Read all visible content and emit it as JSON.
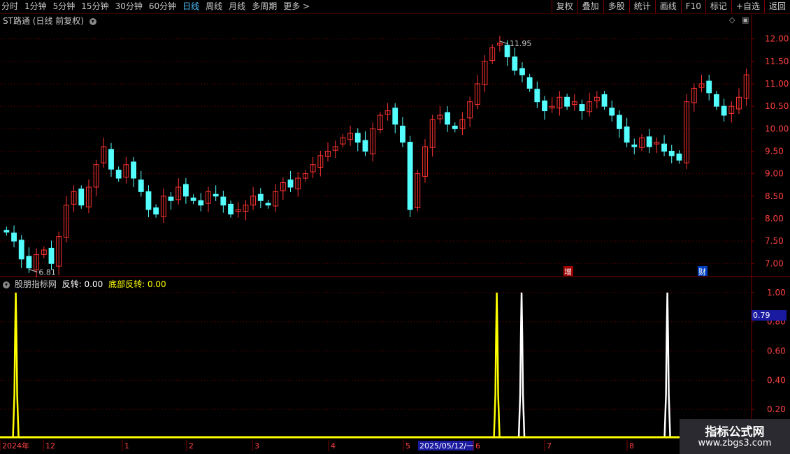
{
  "toolbar": {
    "periods": [
      "分时",
      "1分钟",
      "5分钟",
      "15分钟",
      "30分钟",
      "60分钟",
      "日线",
      "周线",
      "月线",
      "多周期",
      "更多 >"
    ],
    "active_period": "日线",
    "right_buttons": [
      "复权",
      "叠加",
      "多股",
      "统计",
      "画线",
      "F10",
      "标记",
      "+自选",
      "返回"
    ]
  },
  "stock": {
    "name": "ST路通",
    "mode": "(日线 前复权)",
    "high_label": "11.95",
    "low_label": "6.81",
    "badges": [
      "增",
      "财"
    ]
  },
  "indicator": {
    "name": "股朋指标网",
    "label1": "反转:",
    "value1": "0.00",
    "label2": "底部反转:",
    "value2": "0.00",
    "current_value": "0.79",
    "colors": {
      "fanzhuan": "#ffffff",
      "dibu": "#ffff00"
    }
  },
  "price_axis": [
    "12.00",
    "11.50",
    "11.00",
    "10.50",
    "10.00",
    "9.50",
    "9.00",
    "8.50",
    "8.00",
    "7.50",
    "7.00"
  ],
  "ind_axis": [
    "1.00",
    "0.80",
    "0.60",
    "0.40",
    "0.20"
  ],
  "date_axis": [
    "2024年",
    "12",
    "1",
    "2",
    "3",
    "4",
    "5",
    "2025/05/12/一",
    "6",
    "7",
    "8"
  ],
  "watermark": {
    "line1": "指标公式网",
    "line2": "www.zbgs3.com"
  },
  "colors": {
    "up": "#ff3232",
    "down": "#54ffff",
    "grid": "#7a0000",
    "highlight": "#4fc3ff"
  },
  "chart_data": [
    {
      "type": "candlestick",
      "title": "ST路通 (日线 前复权)",
      "ylim": [
        6.6,
        12.15
      ],
      "close_series_approx": [
        7.7,
        7.5,
        7.1,
        6.9,
        7.2,
        7.3,
        7.0,
        7.6,
        8.3,
        8.6,
        8.3,
        8.7,
        9.2,
        9.6,
        9.1,
        8.9,
        9.2,
        8.9,
        8.6,
        8.2,
        8.1,
        8.5,
        8.4,
        8.7,
        8.5,
        8.4,
        8.3,
        8.6,
        8.5,
        8.3,
        8.1,
        8.2,
        8.3,
        8.5,
        8.4,
        8.3,
        8.6,
        8.8,
        8.7,
        8.9,
        9.0,
        9.2,
        9.4,
        9.5,
        9.6,
        9.8,
        9.9,
        9.7,
        9.5,
        10.0,
        10.3,
        10.4,
        10.1,
        9.7,
        8.2,
        9.0,
        9.6,
        10.2,
        10.3,
        10.1,
        10.0,
        10.2,
        10.6,
        11.0,
        11.5,
        11.8,
        11.9,
        11.6,
        11.3,
        11.2,
        10.9,
        10.6,
        10.4,
        10.5,
        10.7,
        10.5,
        10.6,
        10.4,
        10.6,
        10.7,
        10.5,
        10.3,
        10.0,
        9.7,
        9.6,
        9.8,
        9.6,
        9.7,
        9.5,
        9.4,
        9.3,
        10.6,
        10.9,
        11.0,
        10.8,
        10.5,
        10.3,
        10.5,
        10.7,
        11.2
      ],
      "high_marker": 11.95,
      "low_marker": 6.81
    },
    {
      "type": "line",
      "title": "股朋指标网",
      "ylim": [
        0,
        1.1
      ],
      "series": [
        {
          "name": "反转",
          "spike_x_fraction": [
            0.694,
            0.888
          ],
          "values": [
            1,
            1
          ]
        },
        {
          "name": "底部反转",
          "spike_x_fraction": [
            0.021,
            0.661
          ],
          "values": [
            1,
            1
          ]
        }
      ]
    }
  ]
}
